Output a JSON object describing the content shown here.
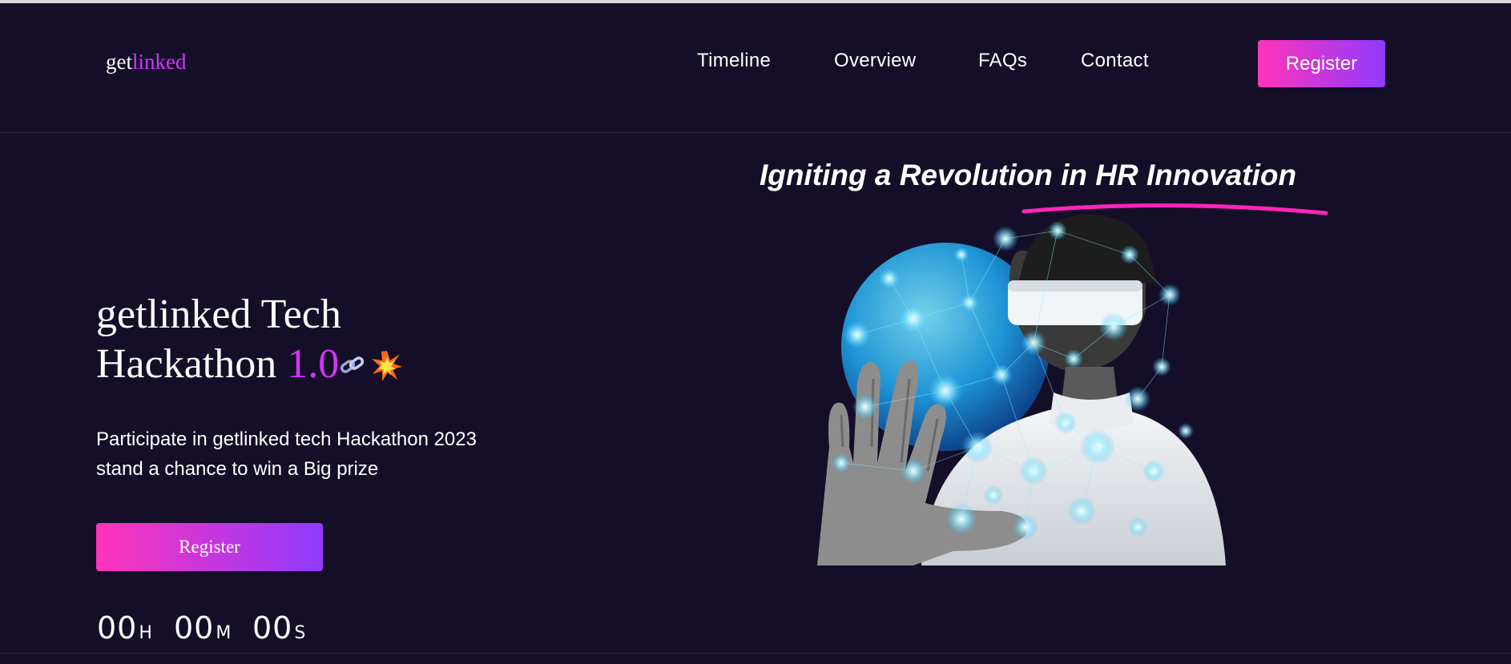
{
  "header": {
    "logo_prefix": "get",
    "logo_accent": "linked",
    "nav": [
      "Timeline",
      "Overview",
      "FAQs",
      "Contact"
    ],
    "register_label": "Register"
  },
  "hero": {
    "tagline": "Igniting a Revolution in HR Innovation",
    "title_line1": "getlinked Tech",
    "title_line2": "Hackathon",
    "title_version": "1.0",
    "title_icons": [
      "chain-link-icon",
      "explosion-icon"
    ],
    "description_line1": "Participate in getlinked tech Hackathon 2023",
    "description_line2": "stand a chance to win a Big prize",
    "register_label": "Register",
    "illustration": "vr-headset-person-illustration"
  },
  "countdown": {
    "hours": "00",
    "hours_unit": "H",
    "minutes": "00",
    "minutes_unit": "M",
    "seconds": "00",
    "seconds_unit": "S"
  },
  "colors": {
    "background": "#150e28",
    "accent_purple": "#d434fe",
    "gradient_start": "#fe34b9",
    "gradient_end": "#903aff"
  }
}
